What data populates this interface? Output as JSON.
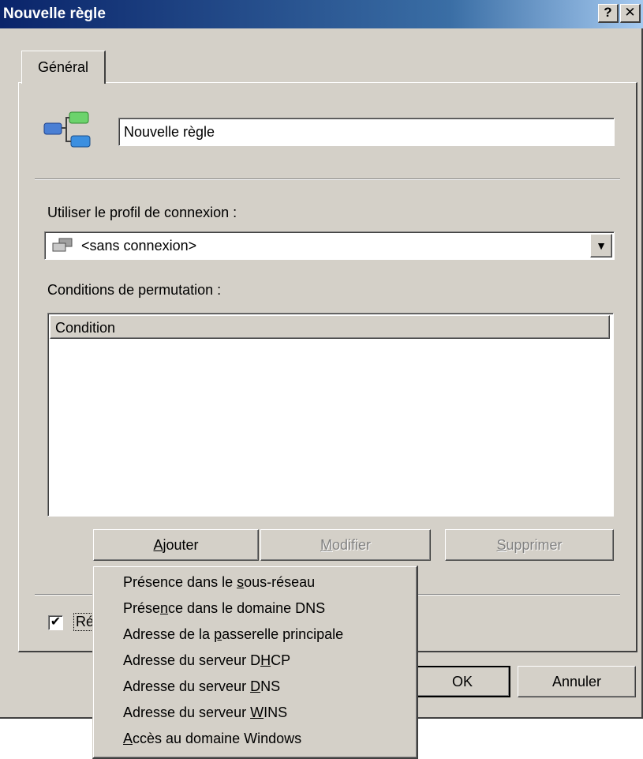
{
  "window": {
    "title": "Nouvelle règle",
    "help_button": "?",
    "close_button": "✕"
  },
  "tabs": [
    {
      "label": "Général"
    }
  ],
  "rule": {
    "name_value": "Nouvelle règle",
    "icon": "rule-tree-icon"
  },
  "connection": {
    "label": "Utiliser le profil de connexion :",
    "selected_value": "<sans connexion>",
    "icon": "network-connection-icon"
  },
  "conditions": {
    "label": "Conditions de permutation :",
    "column_header": "Condition"
  },
  "buttons": {
    "add": {
      "prefix": "",
      "accel": "A",
      "suffix": "jouter"
    },
    "modify": {
      "prefix": "",
      "accel": "M",
      "suffix": "odifier"
    },
    "delete": {
      "prefix": "",
      "accel": "S",
      "suffix": "upprimer"
    },
    "ok": "OK",
    "cancel": "Annuler"
  },
  "checkbox": {
    "checked": true,
    "label_visible": "Ré"
  },
  "menu": {
    "items": [
      {
        "prefix": "Présence dans le ",
        "accel": "s",
        "suffix": "ous-réseau"
      },
      {
        "prefix": "Prése",
        "accel": "n",
        "suffix": "ce dans le domaine DNS"
      },
      {
        "prefix": "Adresse de la ",
        "accel": "p",
        "suffix": "asserelle principale"
      },
      {
        "prefix": "Adresse du serveur D",
        "accel": "H",
        "suffix": "CP"
      },
      {
        "prefix": "Adresse du serveur ",
        "accel": "D",
        "suffix": "NS"
      },
      {
        "prefix": "Adresse du serveur ",
        "accel": "W",
        "suffix": "INS"
      },
      {
        "prefix": "",
        "accel": "A",
        "suffix": "ccès au domaine Windows"
      }
    ]
  }
}
